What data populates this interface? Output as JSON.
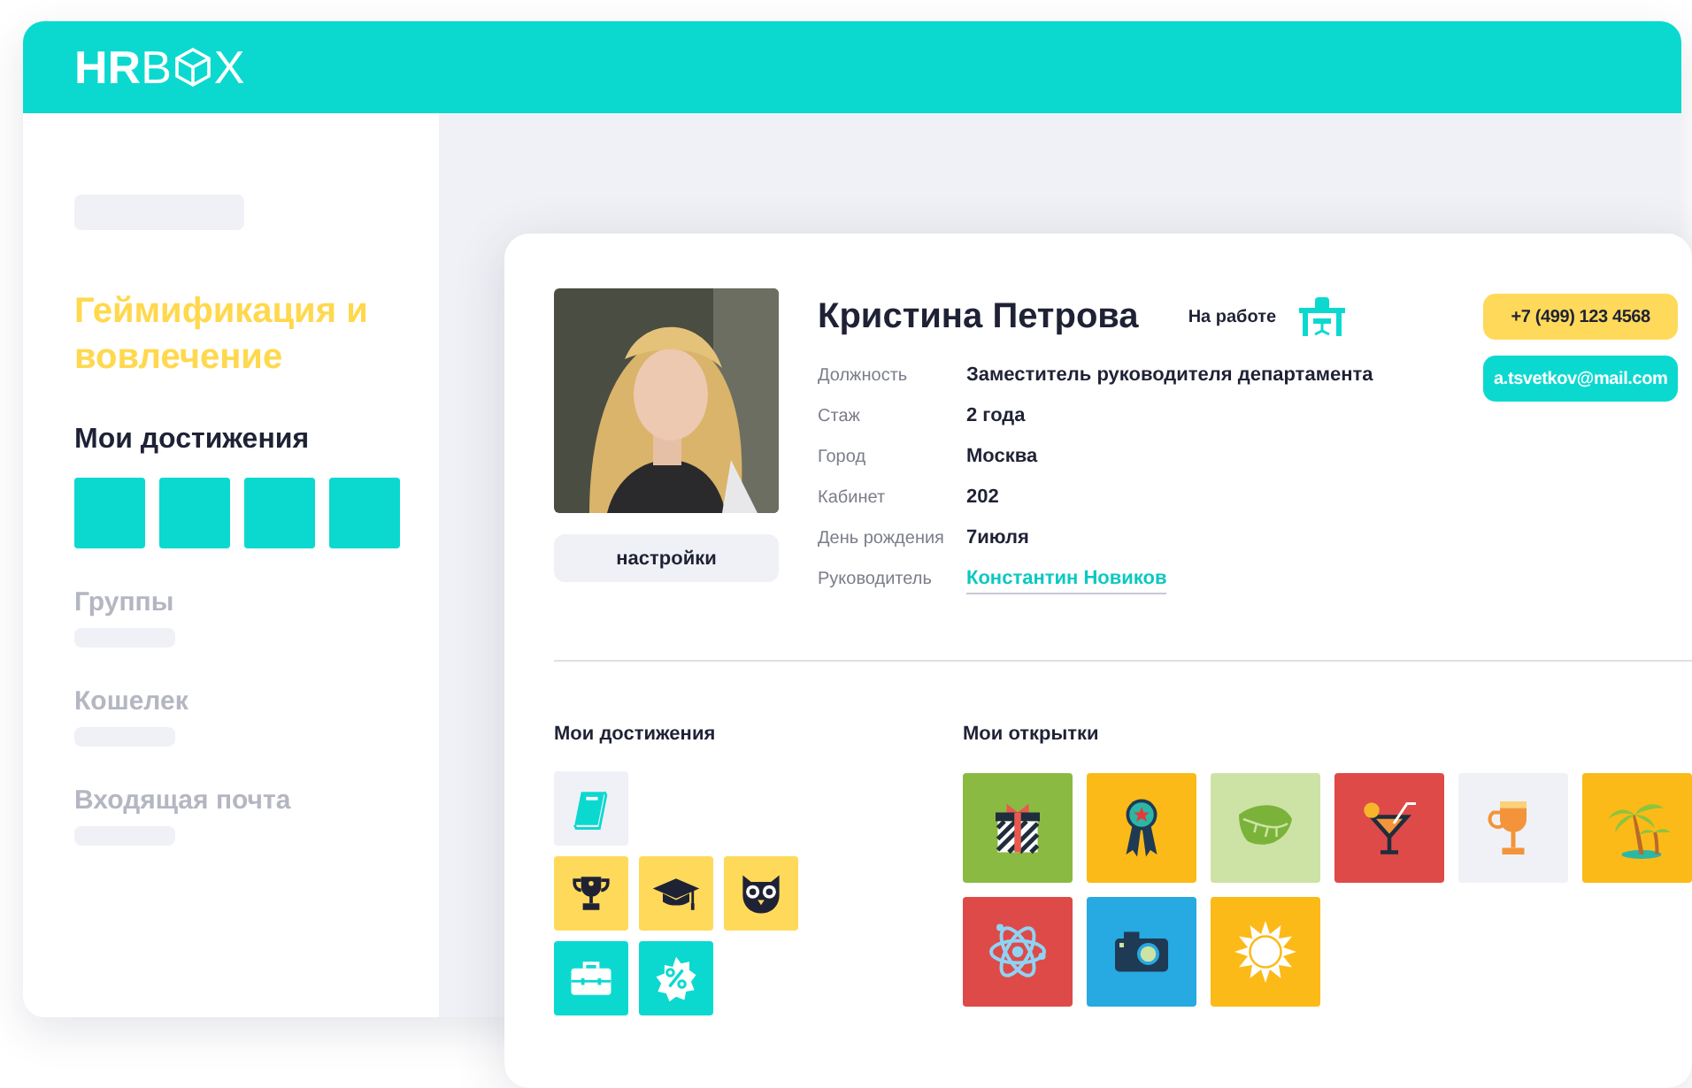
{
  "header": {
    "logo": [
      "HR",
      "B",
      "X"
    ]
  },
  "sidebar": {
    "title": "Геймификация и вовлечение",
    "section": "Мои достижения",
    "items": [
      {
        "label": "Группы"
      },
      {
        "label": "Кошелек"
      },
      {
        "label": "Входящая почта"
      }
    ]
  },
  "profile": {
    "settings_button": "настройки",
    "name": "Кристина Петрова",
    "status": "На работе",
    "phone": "+7 (499) 123 4568",
    "email": "a.tsvetkov@mail.com",
    "fields": [
      {
        "label": "Должность",
        "value": "Заместитель руководителя департамента",
        "kind": "text"
      },
      {
        "label": "Стаж",
        "value": "2 года",
        "kind": "text"
      },
      {
        "label": "Город",
        "value": "Москва",
        "kind": "text"
      },
      {
        "label": "Кабинет",
        "value": "202",
        "kind": "text"
      },
      {
        "label": "День рождения",
        "value": "7июля",
        "kind": "text"
      },
      {
        "label": "Руководитель",
        "value": "Константин Новиков",
        "kind": "link"
      }
    ]
  },
  "achievements": {
    "title": "Мои достижения",
    "rows": [
      {
        "items": [
          {
            "kind": "book",
            "color": "#f0f1f6"
          }
        ]
      },
      {
        "items": [
          {
            "kind": "trophy",
            "color": "#ffd95a"
          },
          {
            "kind": "cap",
            "color": "#ffd95a"
          },
          {
            "kind": "owl",
            "color": "#ffd95a"
          }
        ]
      },
      {
        "items": [
          {
            "kind": "briefcase",
            "color": "#0bd9d0"
          },
          {
            "kind": "percent",
            "color": "#0bd9d0"
          }
        ]
      }
    ]
  },
  "postcards": {
    "title": "Мои открытки",
    "items": [
      {
        "kind": "gift",
        "color": "#8aba42"
      },
      {
        "kind": "medal",
        "color": "#fbba17"
      },
      {
        "kind": "leaf",
        "color": "#cde3a5"
      },
      {
        "kind": "cocktail",
        "color": "#de4a48"
      },
      {
        "kind": "goblet",
        "color": "#f0f1f6"
      },
      {
        "kind": "palm",
        "color": "#fbba17"
      },
      {
        "kind": "atom",
        "color": "#de4a48"
      },
      {
        "kind": "camera",
        "color": "#27a9e1"
      },
      {
        "kind": "sun",
        "color": "#fbba17"
      }
    ]
  }
}
